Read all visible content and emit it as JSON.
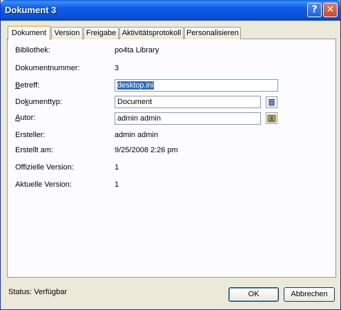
{
  "window": {
    "title": "Dokument 3",
    "help_glyph": "?",
    "close_glyph": "✕"
  },
  "tabs": [
    {
      "label": "Dokument",
      "active": true
    },
    {
      "label": "Version",
      "active": false
    },
    {
      "label": "Freigabe",
      "active": false
    },
    {
      "label": "Aktivitätsprotokoll",
      "active": false
    },
    {
      "label": "Personalisieren",
      "active": false
    }
  ],
  "fields": {
    "bibliothek": {
      "label": "Bibliothek:",
      "value": "po4ta Library"
    },
    "dokumentnummer": {
      "label": "Dokumentnummer:",
      "value": "3"
    },
    "betreff": {
      "label_prefix": "B",
      "label_rest": "etreff:",
      "value": "desktop.ini"
    },
    "dokumenttyp": {
      "label_prefix": "Do",
      "label_accel": "k",
      "label_rest": "umenttyp:",
      "value": "Document"
    },
    "autor": {
      "label_prefix": "A",
      "label_rest": "utor:",
      "value": "admin admin"
    },
    "ersteller": {
      "label": "Ersteller:",
      "value": "admin admin"
    },
    "erstellt_am": {
      "label": "Erstellt am:",
      "value": "9/25/2008 2:26 pm"
    },
    "offizielle_version": {
      "label": "Offizielle Version:",
      "value": "1"
    },
    "aktuelle_version": {
      "label": "Aktuelle Version:",
      "value": "1"
    }
  },
  "icons": {
    "dokumenttyp_picker": "list-icon",
    "autor_picker": "user-lookup-icon"
  },
  "status": "Status: Verfügbar",
  "buttons": {
    "ok": "OK",
    "cancel": "Abbrechen"
  },
  "colors": {
    "titlebar": "#0a5fe0",
    "selection": "#316ac5",
    "active_tab_accent": "#ffc83c",
    "dialog_bg": "#ece9d8"
  }
}
